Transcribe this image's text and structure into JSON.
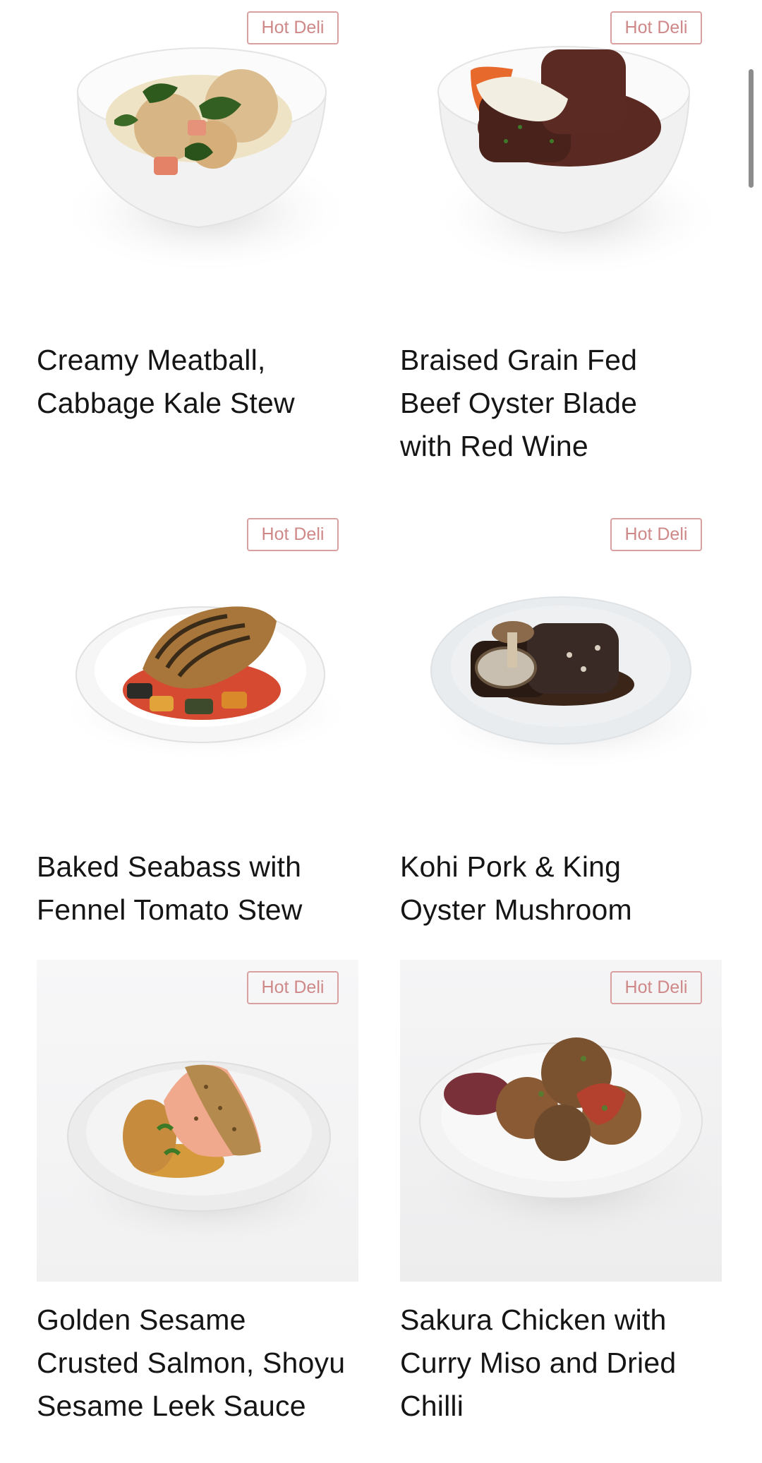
{
  "products": [
    {
      "name": "Creamy Meatball, Cabbage Kale Stew",
      "badge": "Hot Deli",
      "image_icon": "meatball-stew-bowl-image"
    },
    {
      "name": "Braised Grain Fed Beef Oyster Blade with Red Wine",
      "badge": "Hot Deli",
      "image_icon": "braised-beef-bowl-image"
    },
    {
      "name": "Baked Seabass with Fennel Tomato Stew",
      "badge": "Hot Deli",
      "image_icon": "seabass-plate-image"
    },
    {
      "name": "Kohi Pork & King Oyster Mushroom",
      "badge": "Hot Deli",
      "image_icon": "pork-mushroom-plate-image"
    },
    {
      "name": "Golden Sesame Crusted Salmon, Shoyu Sesame Leek Sauce",
      "badge": "Hot Deli",
      "image_icon": "salmon-plate-image"
    },
    {
      "name": "Sakura Chicken with Curry Miso and Dried Chilli",
      "badge": "Hot Deli",
      "image_icon": "chicken-plate-image"
    }
  ],
  "colors": {
    "badge_border": "#d9a0a0",
    "badge_text": "#cf8888",
    "text": "#151515"
  }
}
